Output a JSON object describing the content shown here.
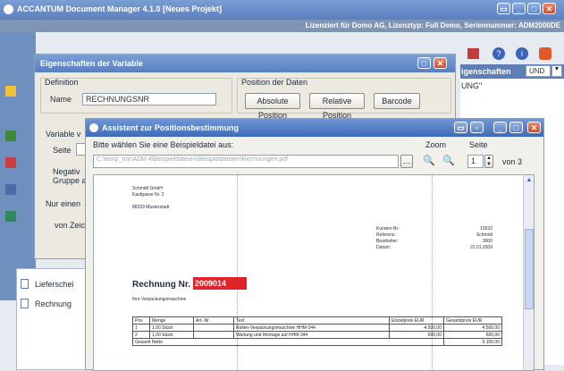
{
  "main_window": {
    "title": "ACCANTUM Document Manager 4.1.0 [Neues Projekt]",
    "license": "Lizenziert für Domo AG, Lizenztyp: Full Demo, Seriennummer: ADM2000DE",
    "right_panel": {
      "header": "igenschaften",
      "dropdown": "UND",
      "text": "UNG\""
    },
    "list_items": [
      "Lieferschei",
      "Rechnung"
    ]
  },
  "props_dialog": {
    "title": "Eigenschaften der Variable",
    "group_definition": "Definition",
    "name_label": "Name",
    "name_value": "RECHNUNGSNR",
    "group_position": "Position der Daten",
    "btn_absolute": "Absolute Position",
    "btn_relative": "Relative Position",
    "btn_barcode": "Barcode",
    "variable_label": "Variable v",
    "seite_label": "Seite",
    "negativ_label": "Negativ",
    "gruppe_label": "Gruppe a",
    "nur_einen_label": "Nur einen",
    "von_zeichen_label": "von Zeic"
  },
  "assistant": {
    "title": "Assistent zur Positionsbestimmung",
    "prompt": "Bitte wählen Sie eine Beispieldatei aus:",
    "path": "C:\\temp_tmr\\ADM 4\\Beispieldateien\\Beispieldateien\\Rechnungen.pdf",
    "zoom_label": "Zoom",
    "page_label": "Seite",
    "page_value": "1",
    "page_total": "von 3"
  },
  "document": {
    "sender_line1": "Schmidt GmbH",
    "sender_line2": "Kaufgasse Nr. 2",
    "sender_line3": "88329 Musterstadt",
    "meta_labels": [
      "Kunden-Nr.:",
      "Referenz:",
      "Bearbeiter:",
      "Datum:"
    ],
    "meta_values": [
      "10032",
      "Schmidt",
      "3000",
      "22.01.2009"
    ],
    "invoice_label": "Rechnung Nr.",
    "invoice_number": "2009014",
    "subject": "Ihre Verpackungsmaschine",
    "table_headers": [
      "Pos",
      "Menge",
      "Art.-Nr",
      "Text",
      "Einzelpreis EUR",
      "Gesamtpreis EUR"
    ],
    "table_rows": [
      [
        "1",
        "1,00 Stück",
        "",
        "Rollen-Verpackungsmaschine HHM-344",
        "4.500,00",
        "4.500,00"
      ],
      [
        "2",
        "1,00 Stück",
        "",
        "Wartung und Montage auf HHM-344",
        "600,00",
        "600,00"
      ]
    ],
    "total_label": "Gesamt Netto",
    "total_value": "5.100,00"
  },
  "colors": {
    "titlebar": "#5a7fbf",
    "highlight": "#e0242a",
    "dialog_bg": "#ece9e0"
  }
}
